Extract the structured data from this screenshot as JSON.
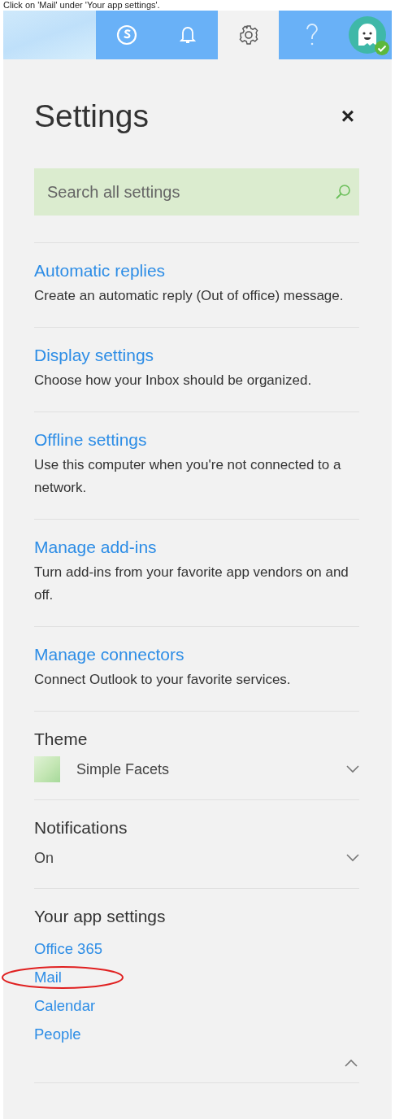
{
  "caption": "Click on 'Mail' under 'Your app settings'.",
  "topbar": {
    "buttons": [
      {
        "kind": "skype",
        "selected": false
      },
      {
        "kind": "bell",
        "selected": false
      },
      {
        "kind": "gear",
        "selected": true
      },
      {
        "kind": "help",
        "selected": false
      }
    ],
    "avatar": {
      "online": true
    }
  },
  "panel": {
    "title": "Settings",
    "close": "×",
    "search": {
      "placeholder": "Search all settings"
    },
    "links": [
      {
        "title": "Automatic replies",
        "description": "Create an automatic reply (Out of office) message."
      },
      {
        "title": "Display settings",
        "description": "Choose how your Inbox should be organized."
      },
      {
        "title": "Offline settings",
        "description": "Use this computer when you're not connected to a network."
      },
      {
        "title": "Manage add-ins",
        "description": "Turn add-ins from your favorite app vendors on and off."
      },
      {
        "title": "Manage connectors",
        "description": "Connect Outlook to your favorite services."
      }
    ],
    "dropdowns": [
      {
        "kind": "theme",
        "label": "Theme",
        "value": "Simple Facets"
      },
      {
        "kind": "plain",
        "label": "Notifications",
        "value": "On"
      }
    ],
    "app_settings": {
      "title": "Your app settings",
      "expanded": true,
      "links": [
        {
          "label": "Office 365",
          "highlighted": false
        },
        {
          "label": "Mail",
          "highlighted": true
        },
        {
          "label": "Calendar",
          "highlighted": false
        },
        {
          "label": "People",
          "highlighted": false
        }
      ]
    }
  }
}
